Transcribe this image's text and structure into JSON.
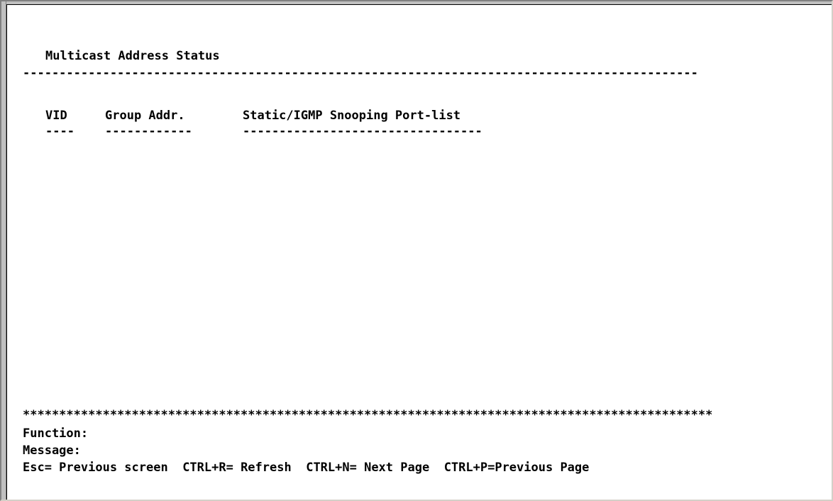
{
  "screen": {
    "title": "Multicast Address Status",
    "rule": "---------------------------------------------------------------------------------------------",
    "table": {
      "columns": [
        "VID",
        "Group Addr.",
        "Static/IGMP Snooping Port-list"
      ],
      "underlines": [
        "----",
        "------------",
        "---------------------------------"
      ],
      "rows": []
    },
    "stars": "***********************************************************************************************",
    "function_label": "Function:",
    "message_label": "Message:",
    "keys": [
      "Esc= Previous screen",
      "CTRL+R= Refresh",
      "CTRL+N= Next Page",
      "CTRL+P=Previous Page"
    ]
  }
}
